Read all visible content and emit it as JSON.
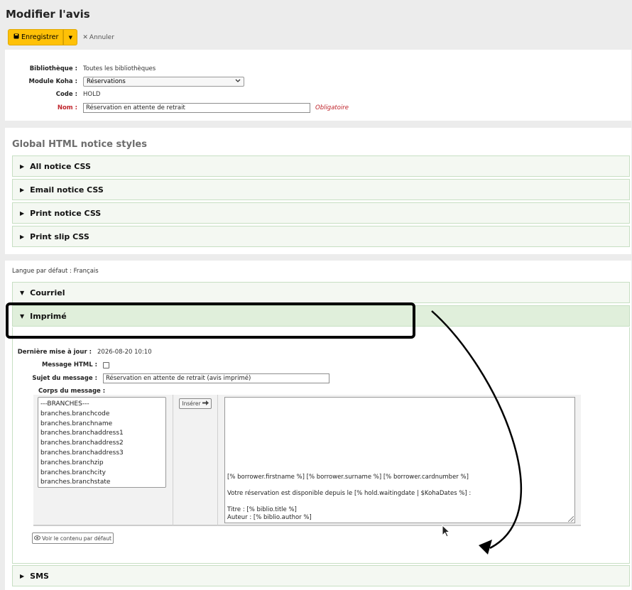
{
  "page": {
    "title": "Modifier l'avis"
  },
  "toolbar": {
    "save_label": "Enregistrer",
    "cancel_label": "Annuler"
  },
  "form": {
    "library": {
      "label": "Bibliothèque :",
      "value": "Toutes les bibliothèques"
    },
    "module": {
      "label": "Module Koha :",
      "value": "Réservations"
    },
    "code": {
      "label": "Code :",
      "value": "HOLD"
    },
    "name": {
      "label": "Nom :",
      "value": "Réservation en attente de retrait",
      "required_note": "Obligatoire"
    }
  },
  "global_styles": {
    "heading": "Global HTML notice styles",
    "items": [
      {
        "label": "All notice CSS"
      },
      {
        "label": "Email notice CSS"
      },
      {
        "label": "Print notice CSS"
      },
      {
        "label": "Print slip CSS"
      }
    ]
  },
  "language": {
    "text": "Langue par défaut : Français"
  },
  "transports": {
    "courriel": "Courriel",
    "imprime": "Imprimé",
    "sms": "SMS"
  },
  "imprime": {
    "last_update_label": "Dernière mise à jour :",
    "last_update_value": "2026-08-20 10:10",
    "html_label": "Message HTML :",
    "subject_label": "Sujet du message :",
    "subject_value": "Réservation en attente de retrait (avis imprimé)",
    "body_label": "Corps du message :",
    "fields": [
      "---BRANCHES---",
      "branches.branchcode",
      "branches.branchname",
      "branches.branchaddress1",
      "branches.branchaddress2",
      "branches.branchaddress3",
      "branches.branchzip",
      "branches.branchcity",
      "branches.branchstate"
    ],
    "insert_label": "Insérer",
    "body_lines": [
      "[% borrower.firstname %] [% borrower.surname %] [% borrower.cardnumber %]",
      "Votre réservation est disponible depuis le [% hold.waitingdate | $KohaDates %] :",
      "Titre : [% biblio.title %]",
      "Auteur : [% biblio.author %]"
    ],
    "default_btn_label": "Voir le contenu par défaut"
  },
  "colors": {
    "accent": "#ffc107",
    "required": "#c0262d",
    "accordion_bg": "#f4f8f2",
    "accordion_border": "#c7dfc3"
  }
}
